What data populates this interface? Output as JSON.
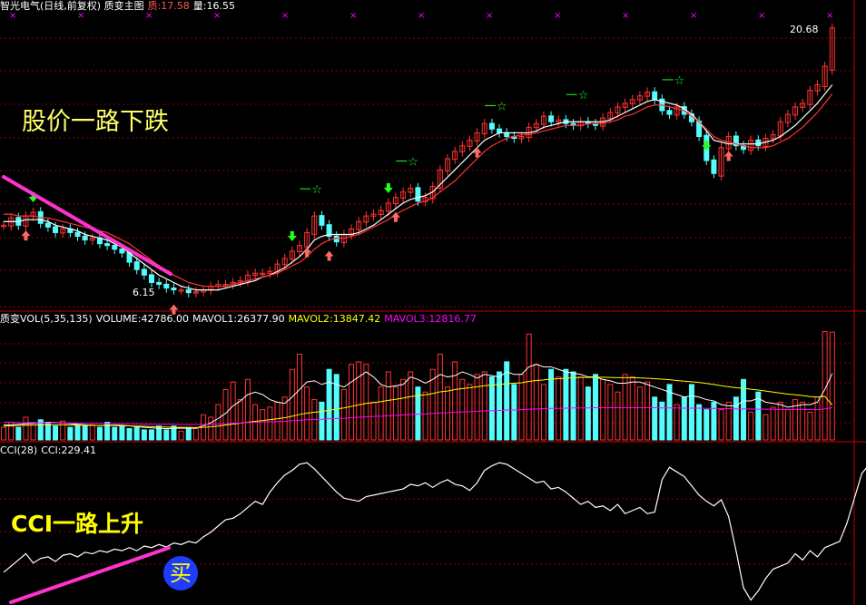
{
  "header_main": {
    "title": "智光电气(日线,前复权) 质变主图",
    "label_a": "质:17.58",
    "label_b": "量:16.55"
  },
  "header_vol": {
    "title": "质变VOL(5,35,135)",
    "volume": "VOLUME:42786.00",
    "mavol1": "MAVOL1:26377.90",
    "mavol2": "MAVOL2:13847.42",
    "mavol3": "MAVOL3:12816.77"
  },
  "header_cci": {
    "title": "CCI(28)",
    "value": "CCI:229.41"
  },
  "annotations": {
    "price_text": "股价一路下跌",
    "cci_text": "CCI一路上升",
    "buy_label": "买",
    "high_label": "20.68",
    "low_label": "6.15"
  },
  "colors": {
    "up": "#ff3333",
    "down": "#54fcfc",
    "ma_fast": "#ffffff",
    "ma_mid": "#ffff00",
    "ma_slow": "#ff00ff",
    "trend_line": "#ff33cc",
    "grid": "#8b0000",
    "header_accent": "#ff5555",
    "buy_circle": "#1e3cff"
  },
  "chart_data": [
    {
      "type": "candlestick",
      "title": "智光电气(日线,前复权) 质变主图",
      "ylim": [
        5.5,
        21.5
      ],
      "annotations": [
        "股价一路下跌",
        "20.68",
        "6.15"
      ],
      "close": [
        10.0,
        10.4,
        10.0,
        10.5,
        10.7,
        10.1,
        9.9,
        9.6,
        9.8,
        9.6,
        9.4,
        9.2,
        9.3,
        9.0,
        8.9,
        8.7,
        8.5,
        8.0,
        7.6,
        7.3,
        6.9,
        6.8,
        6.6,
        6.5,
        6.5,
        6.35,
        6.4,
        6.5,
        6.7,
        6.8,
        6.8,
        6.9,
        7.0,
        7.3,
        7.4,
        7.4,
        7.5,
        7.9,
        8.2,
        8.6,
        8.9,
        9.6,
        10.5,
        10.0,
        9.4,
        9.1,
        9.5,
        9.8,
        10.2,
        10.5,
        10.6,
        10.8,
        11.2,
        11.5,
        11.8,
        12.0,
        11.3,
        11.5,
        12.1,
        13.0,
        13.6,
        14.0,
        14.3,
        14.6,
        15.0,
        15.5,
        15.2,
        15.0,
        14.8,
        14.7,
        14.8,
        15.3,
        15.5,
        15.9,
        15.6,
        15.7,
        15.5,
        15.4,
        15.6,
        15.5,
        15.4,
        15.8,
        16.1,
        16.4,
        16.6,
        16.8,
        17.0,
        17.2,
        16.8,
        16.2,
        16.0,
        16.4,
        16.0,
        15.6,
        14.8,
        13.5,
        12.8,
        14.2,
        14.8,
        14.3,
        14.1,
        14.6,
        14.3,
        14.7,
        14.9,
        15.6,
        16.0,
        16.4,
        16.6,
        17.3,
        17.6,
        18.6,
        20.68
      ],
      "ma": [
        {
          "values": [
            10.2,
            10.2,
            10.2,
            10.3,
            10.3,
            10.3,
            10.2,
            10.0,
            9.9,
            9.8,
            9.7,
            9.5,
            9.4,
            9.3,
            9.2,
            9.0,
            8.8,
            8.5,
            8.2,
            7.9,
            7.6,
            7.3,
            7.1,
            6.9,
            6.7,
            6.6,
            6.5,
            6.5,
            6.5,
            6.5,
            6.6,
            6.7,
            6.8,
            6.9,
            7.0,
            7.2,
            7.3,
            7.5,
            7.7,
            8.0,
            8.3,
            8.7,
            9.2,
            9.4,
            9.5,
            9.5,
            9.5,
            9.5,
            9.6,
            9.8,
            10.0,
            10.3,
            10.6,
            10.9,
            11.2,
            11.4,
            11.5,
            11.6,
            11.8,
            12.2,
            12.6,
            13.0,
            13.4,
            13.8,
            14.2,
            14.6,
            14.8,
            15.0,
            15.0,
            15.0,
            15.0,
            15.0,
            15.1,
            15.3,
            15.4,
            15.5,
            15.6,
            15.6,
            15.6,
            15.6,
            15.6,
            15.6,
            15.7,
            15.9,
            16.1,
            16.3,
            16.5,
            16.7,
            16.8,
            16.7,
            16.6,
            16.5,
            16.3,
            16.0,
            15.6,
            15.1,
            14.6,
            14.5,
            14.4,
            14.4,
            14.4,
            14.4,
            14.4,
            14.5,
            14.6,
            14.8,
            15.1,
            15.4,
            15.8,
            16.2,
            16.6,
            17.1,
            17.6
          ]
        },
        {
          "values": [
            10.6,
            10.6,
            10.5,
            10.5,
            10.5,
            10.4,
            10.4,
            10.3,
            10.2,
            10.1,
            10.0,
            9.9,
            9.8,
            9.7,
            9.6,
            9.4,
            9.2,
            9.0,
            8.7,
            8.4,
            8.1,
            7.8,
            7.5,
            7.3,
            7.1,
            6.9,
            6.8,
            6.7,
            6.7,
            6.7,
            6.7,
            6.8,
            6.9,
            7.0,
            7.1,
            7.2,
            7.3,
            7.4,
            7.6,
            7.8,
            8.0,
            8.3,
            8.7,
            9.0,
            9.2,
            9.3,
            9.3,
            9.4,
            9.5,
            9.7,
            9.9,
            10.1,
            10.3,
            10.6,
            10.8,
            11.0,
            11.2,
            11.3,
            11.5,
            11.8,
            12.1,
            12.4,
            12.8,
            13.2,
            13.6,
            14.0,
            14.3,
            14.5,
            14.7,
            14.8,
            14.9,
            14.9,
            15.0,
            15.1,
            15.2,
            15.3,
            15.4,
            15.4,
            15.4,
            15.5,
            15.5,
            15.5,
            15.6,
            15.7,
            15.9,
            16.0,
            16.2,
            16.4,
            16.5,
            16.5,
            16.4,
            16.3,
            16.2,
            15.9,
            15.6,
            15.2,
            14.8,
            14.6,
            14.5,
            14.4,
            14.3,
            14.2,
            14.2,
            14.2,
            14.3,
            14.5,
            14.7,
            15.0,
            15.3,
            15.7,
            16.1,
            16.6,
            17.1
          ]
        }
      ]
    },
    {
      "type": "bar",
      "title": "质变VOL(5,35,135)",
      "legend": [
        "VOLUME:42786.00",
        "MAVOL1:26377.90",
        "MAVOL2:13847.42",
        "MAVOL3:12816.77"
      ],
      "ylim": [
        0,
        45000
      ],
      "values": [
        5000,
        7000,
        5000,
        9000,
        6000,
        8000,
        6500,
        5500,
        7500,
        5000,
        6000,
        5500,
        6000,
        5000,
        7000,
        5000,
        5500,
        4500,
        5000,
        4000,
        4000,
        5500,
        4000,
        5500,
        3500,
        5000,
        4500,
        10000,
        9000,
        14000,
        20000,
        23000,
        16000,
        24000,
        14000,
        12000,
        13000,
        15000,
        17000,
        28000,
        34000,
        21000,
        16000,
        15000,
        28000,
        26000,
        20000,
        30000,
        31000,
        30000,
        15000,
        21000,
        27000,
        21000,
        24000,
        27000,
        21000,
        19000,
        28000,
        34000,
        21000,
        31000,
        24000,
        22000,
        26000,
        27000,
        25000,
        27000,
        31000,
        22000,
        26000,
        42000,
        30000,
        22000,
        28000,
        25000,
        28000,
        27000,
        25000,
        21000,
        26000,
        24000,
        22000,
        19000,
        26000,
        25000,
        21000,
        23000,
        17000,
        15000,
        22000,
        14000,
        17000,
        22000,
        14000,
        12000,
        15000,
        12000,
        15000,
        17000,
        24000,
        11000,
        19000,
        10000,
        13000,
        15000,
        12000,
        16000,
        15000,
        11000,
        17000,
        43000,
        42786
      ],
      "series": [
        {
          "name": "MAVOL1",
          "values": [
            6000,
            6000,
            6200,
            6400,
            6600,
            6800,
            7000,
            6900,
            6700,
            6500,
            6200,
            6000,
            5800,
            5700,
            5800,
            5900,
            5800,
            5600,
            5300,
            5000,
            4800,
            4600,
            4500,
            4600,
            4700,
            4600,
            4700,
            5600,
            6800,
            8500,
            10500,
            13500,
            15500,
            18000,
            19000,
            18000,
            16000,
            15000,
            14500,
            17000,
            20000,
            23000,
            23500,
            22000,
            23000,
            22000,
            21000,
            23000,
            25000,
            27000,
            25000,
            22000,
            21000,
            21500,
            22000,
            25000,
            24000,
            22500,
            24000,
            26000,
            25000,
            25500,
            27000,
            26000,
            24500,
            26000,
            25500,
            25000,
            27000,
            26000,
            26000,
            29000,
            30000,
            29000,
            29000,
            28000,
            27000,
            26500,
            26000,
            25000,
            25000,
            24000,
            23500,
            22500,
            22500,
            23000,
            23000,
            22000,
            21000,
            20000,
            19000,
            18000,
            17000,
            17500,
            17000,
            16000,
            15500,
            14000,
            13500,
            13500,
            15500,
            15500,
            16500,
            15000,
            14500,
            14000,
            13000,
            13500,
            14000,
            14000,
            15000,
            20000,
            26378
          ]
        },
        {
          "name": "MAVOL2",
          "values": [
            5500,
            5600,
            5700,
            5800,
            5900,
            6000,
            6000,
            6000,
            6000,
            5900,
            5900,
            5800,
            5800,
            5700,
            5700,
            5700,
            5600,
            5600,
            5500,
            5400,
            5300,
            5200,
            5100,
            5000,
            5000,
            4900,
            4900,
            5000,
            5200,
            5500,
            5900,
            6300,
            6600,
            7000,
            7400,
            7700,
            8000,
            8400,
            8800,
            9400,
            10100,
            10600,
            11000,
            11300,
            11800,
            12300,
            12700,
            13300,
            13900,
            14500,
            14800,
            15200,
            15700,
            16100,
            16600,
            17200,
            17600,
            17900,
            18400,
            19100,
            19400,
            20000,
            20400,
            20700,
            21100,
            21500,
            21800,
            22000,
            22300,
            22500,
            22700,
            23200,
            23600,
            23800,
            24100,
            24300,
            24500,
            24700,
            24800,
            24800,
            24900,
            24900,
            24800,
            24700,
            24700,
            24700,
            24600,
            24500,
            24300,
            24100,
            23900,
            23600,
            23300,
            23100,
            22800,
            22400,
            22000,
            21500,
            21100,
            20700,
            20500,
            20100,
            19800,
            19400,
            19000,
            18600,
            18200,
            17900,
            17600,
            17200,
            17000,
            17300,
            13847
          ]
        },
        {
          "name": "MAVOL3",
          "values": [
            7000,
            7000,
            6900,
            6900,
            6900,
            6800,
            6800,
            6800,
            6700,
            6700,
            6700,
            6600,
            6600,
            6600,
            6500,
            6500,
            6500,
            6400,
            6400,
            6300,
            6300,
            6200,
            6200,
            6200,
            6100,
            6100,
            6100,
            6100,
            6200,
            6300,
            6400,
            6600,
            6700,
            6900,
            7000,
            7100,
            7200,
            7300,
            7400,
            7600,
            7800,
            8000,
            8100,
            8200,
            8400,
            8500,
            8600,
            8800,
            9000,
            9200,
            9300,
            9400,
            9600,
            9700,
            9900,
            10100,
            10200,
            10300,
            10500,
            10700,
            10800,
            11000,
            11100,
            11200,
            11400,
            11500,
            11600,
            11700,
            11900,
            11900,
            12000,
            12200,
            12300,
            12400,
            12500,
            12500,
            12600,
            12700,
            12700,
            12700,
            12800,
            12800,
            12800,
            12800,
            12800,
            12800,
            12800,
            12800,
            12800,
            12700,
            12700,
            12700,
            12600,
            12600,
            12600,
            12500,
            12500,
            12400,
            12400,
            12300,
            12300,
            12300,
            12200,
            12200,
            12200,
            12100,
            12100,
            12100,
            12100,
            12000,
            12000,
            12300,
            12817
          ]
        }
      ]
    },
    {
      "type": "line",
      "title": "CCI(28)",
      "legend": [
        "CCI:229.41"
      ],
      "annotations": [
        "CCI一路上升",
        "买"
      ],
      "ylim": [
        -220,
        250
      ],
      "values": [
        -120,
        -100,
        -80,
        -60,
        -90,
        -75,
        -70,
        -85,
        -65,
        -60,
        -70,
        -55,
        -60,
        -50,
        -55,
        -45,
        -50,
        -40,
        -50,
        -35,
        -40,
        -30,
        -38,
        -25,
        -30,
        -20,
        -25,
        -5,
        10,
        30,
        50,
        55,
        70,
        90,
        110,
        100,
        140,
        170,
        195,
        210,
        230,
        235,
        215,
        190,
        165,
        140,
        120,
        115,
        110,
        125,
        130,
        135,
        140,
        145,
        150,
        165,
        160,
        170,
        155,
        170,
        180,
        165,
        160,
        145,
        170,
        210,
        225,
        235,
        230,
        215,
        200,
        185,
        170,
        175,
        150,
        155,
        140,
        120,
        100,
        110,
        90,
        95,
        80,
        100,
        70,
        80,
        90,
        70,
        75,
        180,
        220,
        205,
        190,
        160,
        130,
        110,
        95,
        115,
        60,
        -50,
        -170,
        -210,
        -180,
        -140,
        -110,
        -100,
        -90,
        -60,
        -80,
        -50,
        -70,
        -40,
        -30,
        -20,
        40,
        120,
        200,
        230
      ]
    }
  ]
}
